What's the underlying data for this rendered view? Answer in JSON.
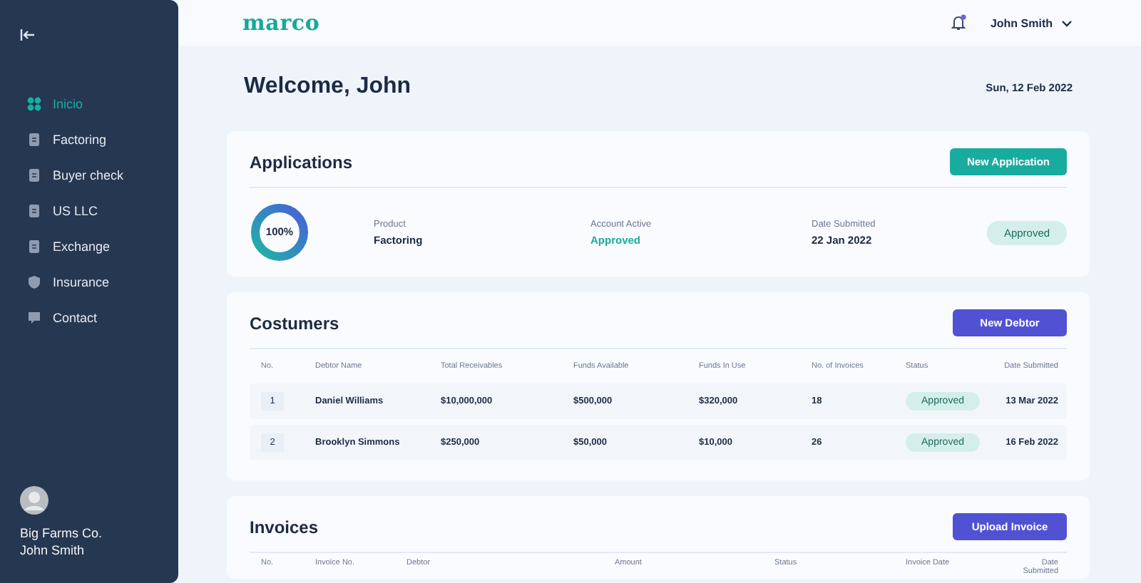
{
  "sidebar": {
    "items": [
      {
        "label": "Inicio",
        "selected": true
      },
      {
        "label": "Factoring",
        "selected": false
      },
      {
        "label": "Buyer check",
        "selected": false
      },
      {
        "label": "US LLC",
        "selected": false
      },
      {
        "label": "Exchange",
        "selected": false
      },
      {
        "label": "Insurance",
        "selected": false
      },
      {
        "label": "Contact",
        "selected": false
      }
    ],
    "company": "Big Farms Co.",
    "user": "John Smith"
  },
  "header": {
    "logo": "marco",
    "user": "John Smith"
  },
  "welcome": {
    "title": "Welcome, John",
    "date": "Sun, 12 Feb 2022"
  },
  "applications": {
    "title": "Applications",
    "button": "New Application",
    "progress": {
      "level": 1,
      "label": "100%"
    },
    "fields": [
      {
        "label": "Product",
        "value": "Factoring",
        "kind": "plain"
      },
      {
        "label": "Account Active",
        "value": "Approved",
        "kind": "accent"
      },
      {
        "label": "Date Submitted",
        "value": "22 Jan 2022",
        "kind": "plain"
      }
    ],
    "status": "Approved"
  },
  "customers": {
    "title": "Costumers",
    "button": "New Debtor",
    "columns": [
      "No.",
      "Debtor Name",
      "Total Receivables",
      "Funds Available",
      "Funds In Use",
      "No. of Invoices",
      "Status",
      "Date Submitted"
    ],
    "rows": [
      [
        "1",
        "Daniel Williams",
        "$10,000,000",
        "$500,000",
        "$320,000",
        "18",
        "Approved",
        "13 Mar 2022"
      ],
      [
        "2",
        "Brooklyn Simmons",
        "$250,000",
        "$50,000",
        "$10,000",
        "26",
        "Approved",
        "16 Feb 2022"
      ]
    ]
  },
  "invoices": {
    "title": "Invoices",
    "button": "Upload Invoice",
    "columns": [
      "No.",
      "Invoice No.",
      "Debtor",
      "Amount",
      "Status",
      "Invoice Date",
      "Date Submitted"
    ]
  }
}
